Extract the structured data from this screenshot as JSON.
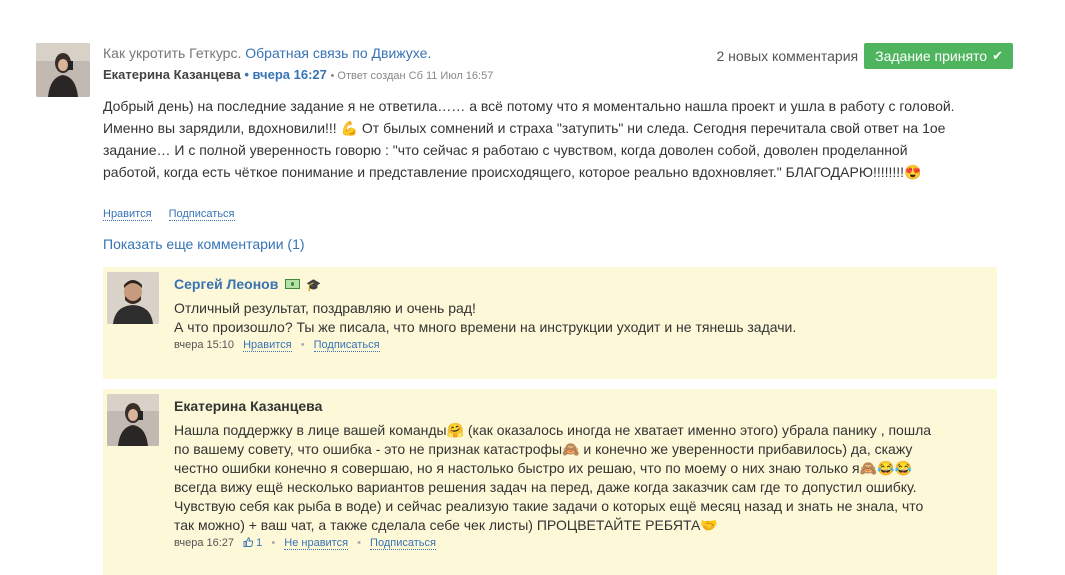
{
  "post": {
    "crumb_course": "Как укротить Геткурс.",
    "crumb_topic": "Обратная связь по Движухе.",
    "author": "Екатерина Казанцева",
    "time": "• вчера 16:27",
    "created": "• Ответ создан Сб 11 Июл 16:57",
    "new_comments": "2 новых комментария",
    "status_button": "Задание принято",
    "body_line1": "Добрый день) на последние задание  я не ответила…… а всё потому что я моментально нашла проект и ушла в работу с головой.",
    "body_line2": "Именно вы зарядили, вдохновили!!! 💪 От былых сомнений  и страха \"затупить\" ни следа. Сегодня перечитала свой ответ на 1ое",
    "body_line3": "задание… И с полной уверенность говорю : \"что сейчас я работаю с чувством, когда доволен собой, доволен проделанной",
    "body_line4": "работой, когда есть чёткое понимание и представление происходящего, которое реально вдохновляет.\" БЛАГОДАРЮ!!!!!!!!😍",
    "like_label": "Нравится",
    "subscribe_label": "Подписаться"
  },
  "show_more": "Показать еще комментарии (1)",
  "comments": [
    {
      "author": "Сергей Леонов",
      "line1": "Отличный результат, поздравляю и очень рад!",
      "line2": "А что произошло? Ты же писала, что много времени на инструкции уходит и не тянешь задачи.",
      "time": "вчера 15:10",
      "like_label": "Нравится",
      "subscribe_label": "Подписаться"
    },
    {
      "author": "Екатерина Казанцева",
      "line1": "Нашла поддержку в лице вашей команды🤗 (как оказалось иногда не хватает именно этого) убрала панику , пошла",
      "line2": "по вашему совету, что ошибка - это не признак катастрофы🙈  и конечно же уверенности прибавилось) да, скажу",
      "line3": "честно ошибки конечно я совершаю, но я настолько быстро их решаю, что по моему о них знаю только я🙈😂😂",
      "line4": "всегда вижу ещё несколько вариантов решения задач на перед, даже когда заказчик сам где то допустил ошибку.",
      "line5": "Чувствую себя как рыба в воде) и сейчас реализую такие задачи о которых ещё месяц назад и знать не знала, что",
      "line6": "так можно) + ваш чат, а также сделала себе чек листы) ПРОЦВЕТАЙТЕ РЕБЯТА🤝",
      "time": "вчера 16:27",
      "like_count": "1",
      "unlike_label": "Не нравится",
      "subscribe_label": "Подписаться"
    }
  ],
  "colors": {
    "link": "#3773b5",
    "accept_green": "#4fb45e",
    "comment_bg": "#fdf8d8"
  }
}
